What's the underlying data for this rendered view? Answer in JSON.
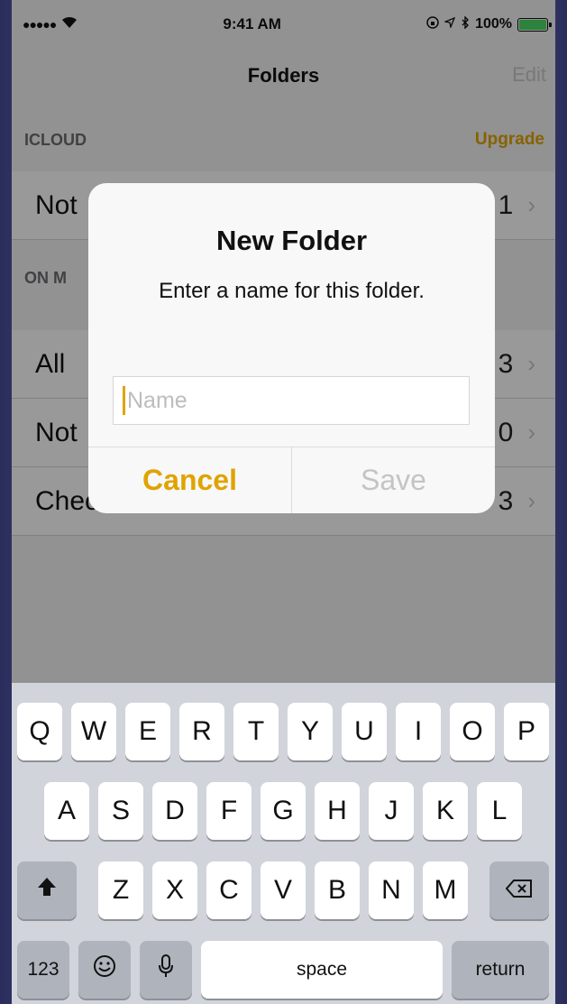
{
  "status_bar": {
    "signal": "●●●●●",
    "wifi_icon": "wifi-icon",
    "time": "9:41 AM",
    "battery": "100%",
    "battery_level_percent": 100
  },
  "nav": {
    "title": "Folders",
    "edit_label": "Edit"
  },
  "sections": [
    {
      "header": "ICLOUD",
      "action": "Upgrade"
    },
    {
      "header": "ON M"
    }
  ],
  "rows": [
    {
      "label": "Not",
      "count": "1"
    },
    {
      "label": "All",
      "count": "3"
    },
    {
      "label": "Not",
      "count": "0"
    },
    {
      "label": "Checklist",
      "count": "3"
    }
  ],
  "alert": {
    "title": "New Folder",
    "message": "Enter a name for this folder.",
    "input_placeholder": "Name",
    "cancel_label": "Cancel",
    "save_label": "Save"
  },
  "keyboard": {
    "row1": [
      "Q",
      "W",
      "E",
      "R",
      "T",
      "Y",
      "U",
      "I",
      "O",
      "P"
    ],
    "row2": [
      "A",
      "S",
      "D",
      "F",
      "G",
      "H",
      "J",
      "K",
      "L"
    ],
    "row3": [
      "Z",
      "X",
      "C",
      "V",
      "B",
      "N",
      "M"
    ],
    "shift": "⬆",
    "backspace": "⌫",
    "numbers": "123",
    "emoji": "☺",
    "mic": "🎙",
    "space": "space",
    "return": "return"
  },
  "colors": {
    "accent": "#e0a300",
    "keyboard_bg": "#d1d4da"
  }
}
